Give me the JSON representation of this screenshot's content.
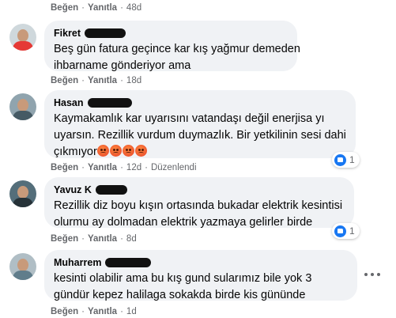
{
  "labels": {
    "like": "Beğen",
    "reply": "Yanıtla",
    "sep": "·",
    "edited": "Düzenlendi"
  },
  "top_actions": {
    "time": "48d"
  },
  "comments": [
    {
      "name": "Fikret",
      "lines": [
        "Beş gün fatura geçince kar kış yağmur demeden",
        "ihbarname gönderiyor ama"
      ],
      "time": "18d"
    },
    {
      "name": "Hasan",
      "lines": [
        "Kaymakamlık kar uyarısını vatandaşı değil enerjisa yı",
        "uyarsın. Rezillik vurdum duymazlık. Bir yetkilinin sesi dahi",
        "çıkmıyor"
      ],
      "emoji": [
        "pouting-face-icon",
        "pouting-face-icon",
        "pouting-face-icon",
        "pouting-face-icon"
      ],
      "time": "12d",
      "reaction_count": "1"
    },
    {
      "name": "Yavuz K",
      "lines": [
        "Rezillik diz boyu kışın ortasında bukadar elektrik kesintisi",
        "olurmu ay dolmadan elektrik yazmaya gelirler birde"
      ],
      "time": "8d",
      "reaction_count": "1"
    },
    {
      "name": "Muharrem",
      "lines": [
        "kesinti olabilir ama bu kış gund sularımız bile yok 3",
        "gündür kepez halilaga sokakda birde kis gününde"
      ],
      "time": "1d"
    }
  ],
  "colors": {
    "bubble_bg": "#f0f2f5",
    "meta_text": "#65676b",
    "like_blue": "#1877f2"
  }
}
